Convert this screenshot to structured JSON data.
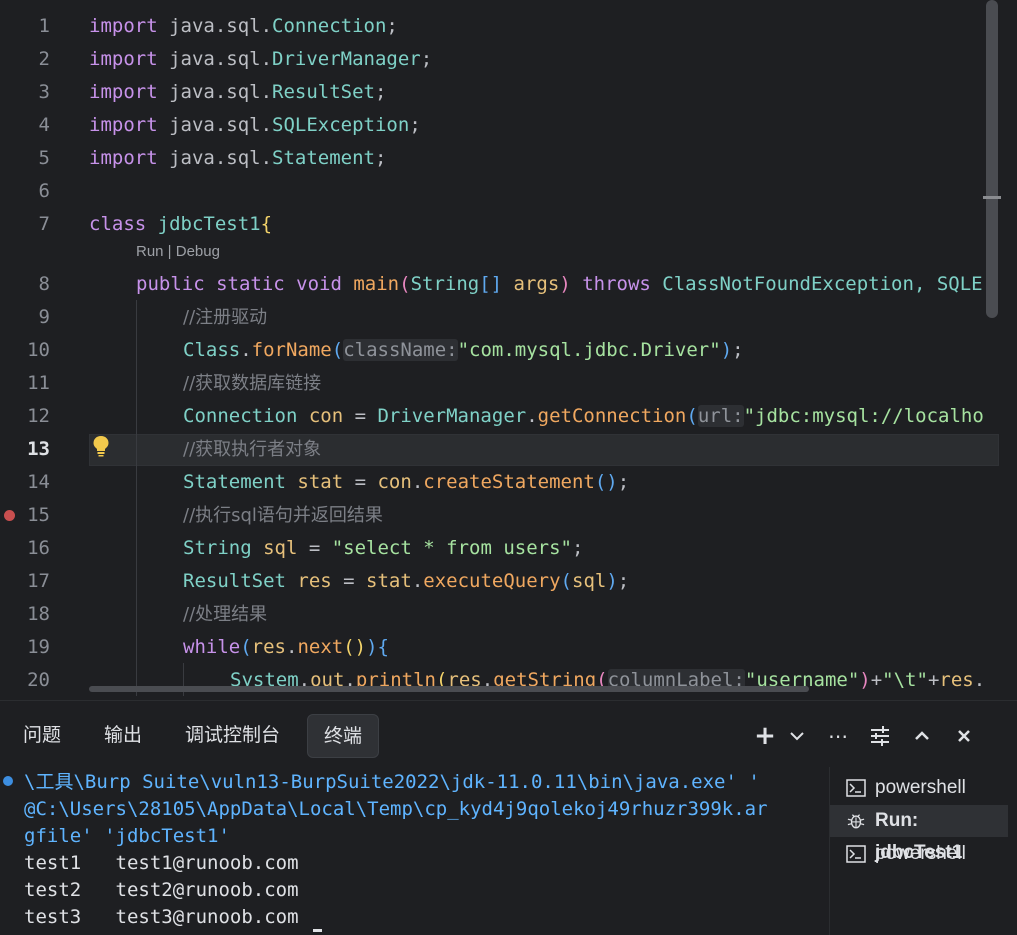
{
  "editor": {
    "line_numbers": [
      "1",
      "2",
      "3",
      "4",
      "5",
      "6",
      "7",
      "8",
      "9",
      "10",
      "11",
      "12",
      "13",
      "14",
      "15",
      "16",
      "17",
      "18",
      "19",
      "20"
    ],
    "active_line": "13",
    "codelens": "Run | Debug",
    "lines": {
      "l1": {
        "kw": "import",
        "rest": " java.sql.",
        "cls": "Connection",
        "end": ";"
      },
      "l2": {
        "kw": "import",
        "rest": " java.sql.",
        "cls": "DriverManager",
        "end": ";"
      },
      "l3": {
        "kw": "import",
        "rest": " java.sql.",
        "cls": "ResultSet",
        "end": ";"
      },
      "l4": {
        "kw": "import",
        "rest": " java.sql.",
        "cls": "SQLException",
        "end": ";"
      },
      "l5": {
        "kw": "import",
        "rest": " java.sql.",
        "cls": "Statement",
        "end": ";"
      },
      "l7": {
        "kw": "class",
        "cls": " jdbcTest1",
        "br": "{"
      },
      "l8": {
        "kw1": "public",
        "kw2": " static",
        "kw3": " void",
        "fn": " main",
        "p1": "(",
        "cls1": "String",
        "arr": "[]",
        "var": " args",
        "p2": ")",
        "kw4": " throws",
        "cls2": " ClassNotFoundException",
        "rest": ", SQLE"
      },
      "l9": {
        "cmt": "//注册驱动"
      },
      "l10": {
        "cls": "Class",
        "dot": ".",
        "fn": "forName",
        "p1": "(",
        "hint": "className:",
        "str": "\"com.mysql.jdbc.Driver\"",
        "p2": ")",
        "end": ";"
      },
      "l11": {
        "cmt": "//获取数据库链接"
      },
      "l12": {
        "cls1": "Connection",
        "var": " con",
        "eq": " = ",
        "cls2": "DriverManager",
        "dot": ".",
        "fn": "getConnection",
        "p1": "(",
        "hint": "url:",
        "str": "\"jdbc:mysql://localho"
      },
      "l13": {
        "cmt": "//获取执行者对象"
      },
      "l14": {
        "cls": "Statement",
        "var": " stat",
        "eq": " = ",
        "var2": "con",
        "dot": ".",
        "fn": "createStatement",
        "p": "()",
        "end": ";"
      },
      "l15": {
        "cmt": "//执行sql语句并返回结果"
      },
      "l16": {
        "cls": "String",
        "var": " sql",
        "eq": " = ",
        "str": "\"select * from users\"",
        "end": ";"
      },
      "l17": {
        "cls": "ResultSet",
        "var": " res",
        "eq": " = ",
        "var2": "stat",
        "dot": ".",
        "fn": "executeQuery",
        "p1": "(",
        "var3": "sql",
        "p2": ")",
        "end": ";"
      },
      "l18": {
        "cmt": "//处理结果"
      },
      "l19": {
        "kw": "while",
        "p1": "(",
        "var": "res",
        "dot": ".",
        "fn": "next",
        "p2": "()",
        "p3": ")",
        "br": "{"
      },
      "l20": {
        "cls": "System",
        "dot": ".",
        "var": "out",
        "dot2": ".",
        "fn": "println",
        "p1": "(",
        "var2": "res",
        "dot3": ".",
        "fn2": "getString",
        "p2": "(",
        "hint": "columnLabel:",
        "str": "\"username\"",
        "p3": ")",
        "plus": "+",
        "str2": "\"\\t\"",
        "plus2": "+",
        "var3": "res",
        "dot4": "."
      }
    }
  },
  "panel": {
    "tabs": [
      "问题",
      "输出",
      "调试控制台",
      "终端"
    ],
    "active_tab": "终端",
    "terminal": [
      "\\工具\\Burp Suite\\vuln13-BurpSuite2022\\jdk-11.0.11\\bin\\java.exe' '",
      "@C:\\Users\\28105\\AppData\\Local\\Temp\\cp_kyd4j9qolekoj49rhuzr399k.ar",
      "gfile' 'jdbcTest1'",
      "test1   test1@runoob.com",
      "test2   test2@runoob.com",
      "test3   test3@runoob.com"
    ],
    "sessions": [
      {
        "label": "powershell",
        "icon": "terminal-icon"
      },
      {
        "label": "Run: jdbcTest1",
        "icon": "debug-bug-icon"
      },
      {
        "label": "powershell",
        "icon": "terminal-icon"
      }
    ]
  },
  "colors": {
    "background": "#1e1f22",
    "keyword": "#c792ea",
    "class": "#7fd1c7",
    "string": "#a6e2a0",
    "function": "#f0a860",
    "terminal_path": "#5fb4ff"
  }
}
